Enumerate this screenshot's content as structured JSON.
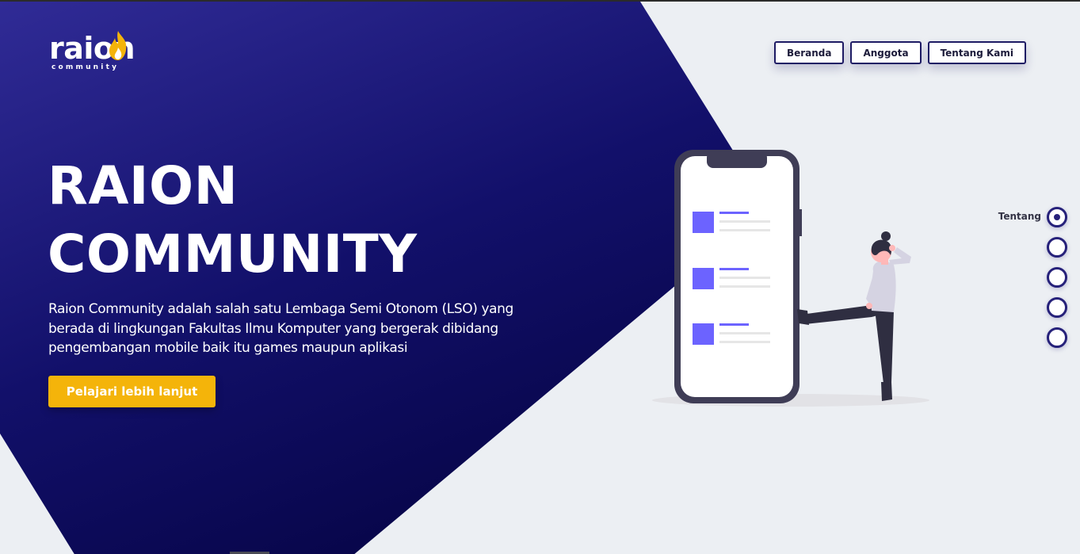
{
  "logo": {
    "word": "raion",
    "sub": "community"
  },
  "nav": {
    "items": [
      {
        "label": "Beranda"
      },
      {
        "label": "Anggota"
      },
      {
        "label": "Tentang Kami"
      }
    ]
  },
  "hero": {
    "title_line1": "RAION",
    "title_line2": "COMMUNITY",
    "description_line1": "Raion Community adalah salah satu Lembaga Semi Otonom (LSO) yang",
    "description_line2": "berada di lingkungan Fakultas Ilmu Komputer yang bergerak dibidang",
    "description_line3": "pengembangan mobile baik itu games maupun aplikasi",
    "cta_label": "Pelajari lebih lanjut"
  },
  "side_nav": {
    "active_label": "Tentang",
    "dot_count": 5,
    "active_index": 0
  },
  "colors": {
    "hero_dark": "#0d0a4e",
    "hero_light": "#2e2a8f",
    "accent": "#f4b40a",
    "illustration_accent": "#6c63ff",
    "background": "#eceff3"
  }
}
